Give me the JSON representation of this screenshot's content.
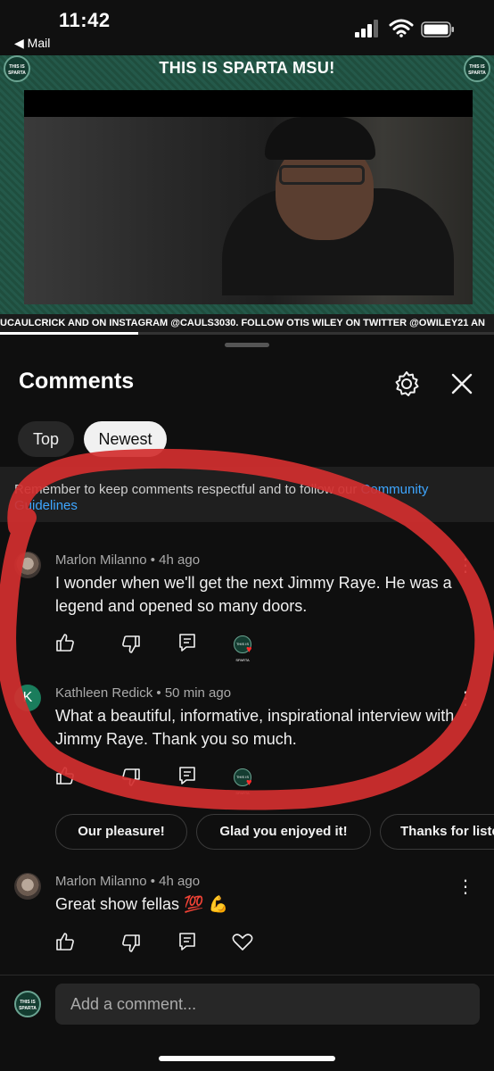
{
  "status_bar": {
    "time": "11:42",
    "back_app": "◀ Mail"
  },
  "video": {
    "title": "THIS IS SPARTA MSU!",
    "badge_text": "THIS IS SPARTA",
    "ticker": "UCAULCRICK AND ON INSTAGRAM @CAULS3030. FOLLOW OTIS WILEY ON TWITTER @OWILEY21 AN",
    "progress": 0.28
  },
  "panel": {
    "title": "Comments",
    "chips": [
      {
        "label": "Top"
      },
      {
        "label": "Newest"
      }
    ],
    "notice": {
      "text": "Remember to keep comments respectful and to follow our ",
      "link": "Community Guidelines"
    }
  },
  "comments": [
    {
      "author": "Marlon Milanno",
      "age": "4h ago",
      "text": "I wonder when we'll get the next Jimmy Raye. He was a legend and opened so many doors."
    },
    {
      "author": "Kathleen Redick",
      "age": "50 min ago",
      "avatar_letter": "K",
      "text": "What a beautiful, informative, inspirational interview with Jimmy Raye. Thank you so much."
    },
    {
      "author": "Marlon Milanno",
      "age": "4h ago",
      "text": "Great show fellas 💯 💪"
    }
  ],
  "meta_separator": "•",
  "kebab_glyph": "⋮",
  "heart_glyph": "♥",
  "suggested_replies": [
    {
      "label": "Our pleasure!"
    },
    {
      "label": "Glad you enjoyed it!"
    },
    {
      "label": "Thanks for listening"
    }
  ],
  "add_comment": {
    "placeholder": "Add a comment..."
  },
  "colors": {
    "accent_link": "#3ea6ff",
    "annotation": "#d32f2f",
    "brand_green": "#1f4e3e"
  }
}
